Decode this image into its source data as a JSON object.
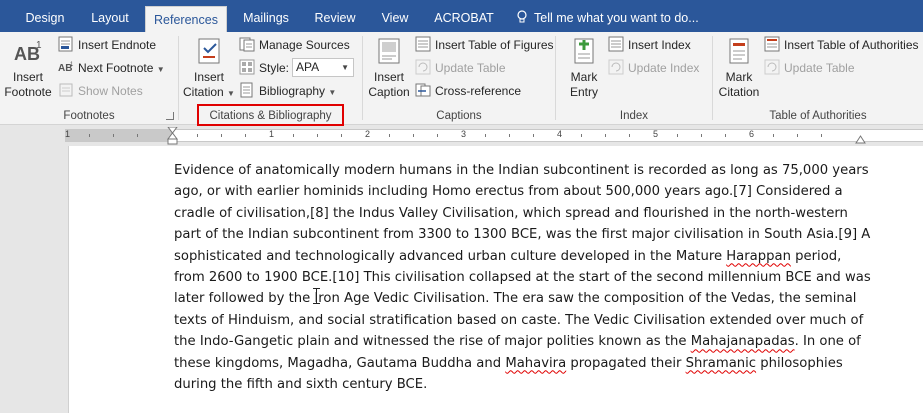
{
  "tabs": [
    "Design",
    "Layout",
    "References",
    "Mailings",
    "Review",
    "View",
    "ACROBAT"
  ],
  "active_tab": "References",
  "tell_me": "Tell me what you want to do...",
  "footnotes": {
    "insert_footnote": [
      "Insert",
      "Footnote"
    ],
    "insert_endnote": "Insert Endnote",
    "next_footnote": "Next Footnote",
    "show_notes": "Show Notes",
    "label": "Footnotes"
  },
  "citations": {
    "insert_citation": [
      "Insert",
      "Citation"
    ],
    "manage_sources": "Manage Sources",
    "style_label": "Style:",
    "style_value": "APA",
    "bibliography": "Bibliography",
    "label": "Citations & Bibliography"
  },
  "captions": {
    "insert_caption": [
      "Insert",
      "Caption"
    ],
    "insert_table_of_figures": "Insert Table of Figures",
    "update_table": "Update Table",
    "cross_reference": "Cross-reference",
    "label": "Captions"
  },
  "index": {
    "mark_entry": [
      "Mark",
      "Entry"
    ],
    "insert_index": "Insert Index",
    "update_index": "Update Index",
    "label": "Index"
  },
  "toa": {
    "mark_citation": [
      "Mark",
      "Citation"
    ],
    "insert_toa": "Insert Table of Authorities",
    "update_table": "Update Table",
    "label": "Table of Authorities"
  },
  "ruler_numbers": [
    "1",
    "2",
    "3",
    "4",
    "5",
    "6"
  ],
  "document_lines": [
    "Evidence of anatomically modern humans in the Indian subcontinent is recorded as long as 75,000 years",
    "ago, or with earlier hominids including Homo erectus from about 500,000 years ago.[7] Considered a",
    "cradle of civilisation,[8] the Indus Valley Civilisation, which spread and flourished in the north-western",
    "part of the Indian subcontinent from 3300 to 1300 BCE, was the first major civilisation in South Asia.[9] A",
    "sophisticated and technologically advanced urban culture developed in the Mature ",
    "from 2600 to 1900 BCE.[10] This civilisation collapsed at the start of the second millennium BCE and was",
    "later followed by the Iron Age Vedic Civilisation. The era saw the composition of the Vedas, the seminal",
    "texts of Hinduism, and social stratification based on caste. The Vedic Civilisation extended over much of",
    "the Indo-Gangetic plain and witnessed the rise of major polities known as the ",
    "these kingdoms, Magadha, Gautama Buddha and ",
    "during the fifth and sixth century BCE."
  ],
  "line5_tail": {
    "misspelled": "Harappan",
    "rest": " period,"
  },
  "line9_tail": {
    "misspelled": "Mahajanapadas",
    "rest": ". In one of"
  },
  "line10_tail": {
    "misspelled1": "Mahavira",
    "middle": " propagated their ",
    "misspelled2": "Shramanic",
    "rest": " philosophies"
  }
}
